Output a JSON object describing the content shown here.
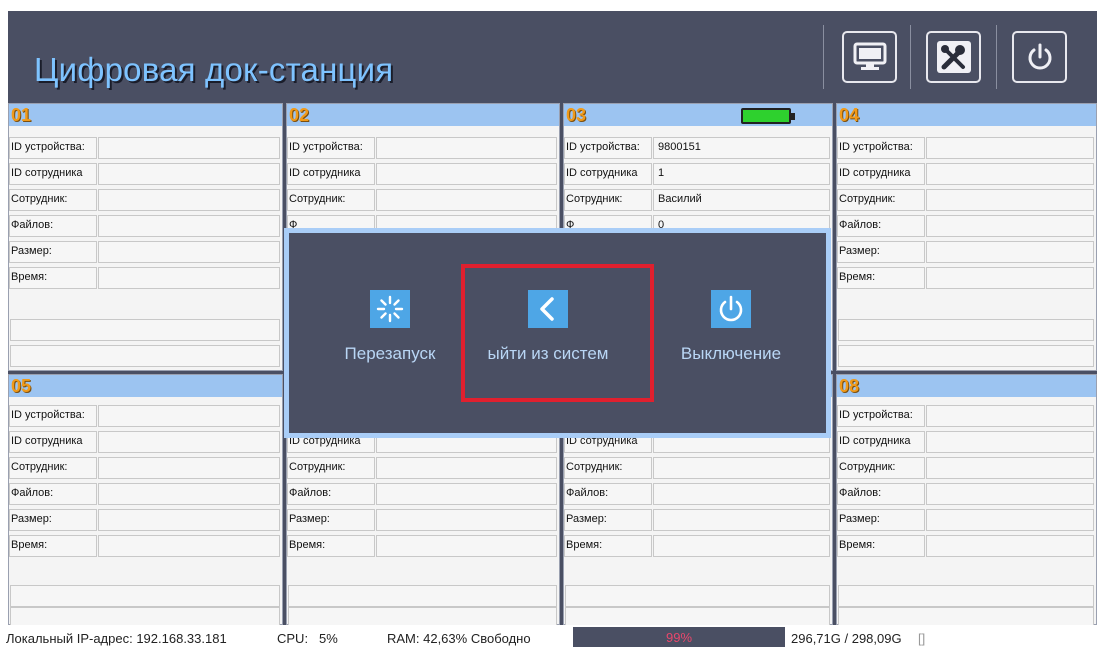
{
  "header": {
    "title": "Цифровая док-станция",
    "buttons": [
      {
        "icon": "monitor-icon"
      },
      {
        "icon": "tools-icon"
      },
      {
        "icon": "power-icon"
      }
    ]
  },
  "panels": [
    {
      "num": "01",
      "battery": false,
      "rows": [
        {
          "label": "ID устройства:",
          "value": ""
        },
        {
          "label": "ID сотрудника",
          "value": ""
        },
        {
          "label": "Сотрудник:",
          "value": ""
        },
        {
          "label": "Файлов:",
          "value": ""
        },
        {
          "label": "Размер:",
          "value": ""
        },
        {
          "label": "Время:",
          "value": ""
        }
      ]
    },
    {
      "num": "02",
      "battery": false,
      "rows": [
        {
          "label": "ID устройства:",
          "value": ""
        },
        {
          "label": "ID сотрудника",
          "value": ""
        },
        {
          "label": "Сотрудник:",
          "value": ""
        },
        {
          "label": "Ф",
          "value": ""
        },
        {
          "label": "",
          "value": ""
        },
        {
          "label": "",
          "value": ""
        }
      ]
    },
    {
      "num": "03",
      "battery": true,
      "battery_color": "#2ed12e",
      "rows": [
        {
          "label": "ID устройства:",
          "value": "9800151"
        },
        {
          "label": "ID сотрудника",
          "value": "1"
        },
        {
          "label": "Сотрудник:",
          "value": "Василий"
        },
        {
          "label": "Ф",
          "value": "0"
        },
        {
          "label": "",
          "value": ""
        },
        {
          "label": "",
          "value": ""
        }
      ]
    },
    {
      "num": "04",
      "battery": false,
      "rows": [
        {
          "label": "ID устройства:",
          "value": ""
        },
        {
          "label": "ID сотрудника",
          "value": ""
        },
        {
          "label": "Сотрудник:",
          "value": ""
        },
        {
          "label": "Файлов:",
          "value": ""
        },
        {
          "label": "Размер:",
          "value": ""
        },
        {
          "label": "Время:",
          "value": ""
        }
      ]
    },
    {
      "num": "05",
      "battery": false,
      "rows": [
        {
          "label": "ID устройства:",
          "value": ""
        },
        {
          "label": "ID сотрудника",
          "value": ""
        },
        {
          "label": "Сотрудник:",
          "value": ""
        },
        {
          "label": "Файлов:",
          "value": ""
        },
        {
          "label": "Размер:",
          "value": ""
        },
        {
          "label": "Время:",
          "value": ""
        }
      ]
    },
    {
      "num": "",
      "battery": false,
      "rows": [
        {
          "label": "",
          "value": ""
        },
        {
          "label": "ID сотрудника",
          "value": ""
        },
        {
          "label": "Сотрудник:",
          "value": ""
        },
        {
          "label": "Файлов:",
          "value": ""
        },
        {
          "label": "Размер:",
          "value": ""
        },
        {
          "label": "Время:",
          "value": ""
        }
      ]
    },
    {
      "num": "",
      "battery": false,
      "rows": [
        {
          "label": "",
          "value": ""
        },
        {
          "label": "ID сотрудника",
          "value": ""
        },
        {
          "label": "Сотрудник:",
          "value": ""
        },
        {
          "label": "Файлов:",
          "value": ""
        },
        {
          "label": "Размер:",
          "value": ""
        },
        {
          "label": "Время:",
          "value": ""
        }
      ]
    },
    {
      "num": "08",
      "battery": false,
      "rows": [
        {
          "label": "ID устройства:",
          "value": ""
        },
        {
          "label": "ID сотрудника",
          "value": ""
        },
        {
          "label": "Сотрудник:",
          "value": ""
        },
        {
          "label": "Файлов:",
          "value": ""
        },
        {
          "label": "Размер:",
          "value": ""
        },
        {
          "label": "Время:",
          "value": ""
        }
      ]
    }
  ],
  "modal": {
    "options": [
      {
        "label": "Перезапуск",
        "icon": "restart-icon"
      },
      {
        "label": "ыйти из систем",
        "icon": "back-arrow-icon"
      },
      {
        "label": "Выключение",
        "icon": "power-icon"
      }
    ]
  },
  "status": {
    "ip": "Локальный IP-адрес: 192.168.33.181",
    "cpu_label": "CPU:",
    "cpu_value": "5%",
    "ram": "RAM: 42,63% Свободно",
    "disk_percent_text": "99%",
    "disk_fraction": 0.99,
    "disk": "296,71G / 298,09G",
    "disk_suffix": "[]"
  },
  "colors": {
    "header_bg": "#4a4f63",
    "title": "#7ec3ff",
    "panel_head": "#9cc4f1",
    "panel_number": "#f09a1a",
    "modal_border": "#a9cdf7",
    "modal_icon_bg": "#4ea6e6",
    "highlight": "#e0202e",
    "battery": "#2ed12e"
  }
}
